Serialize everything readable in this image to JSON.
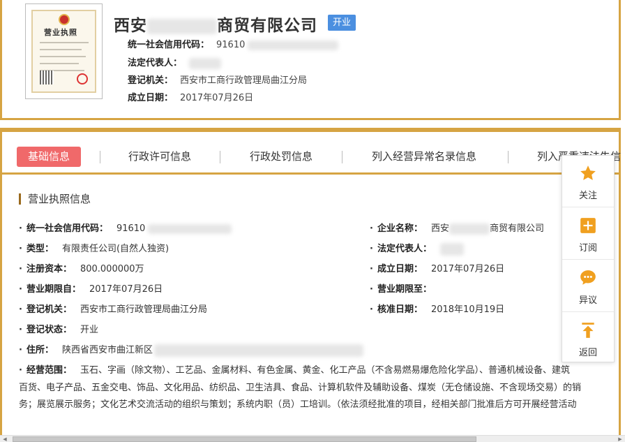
{
  "header": {
    "company_name_prefix": "西安",
    "company_name_suffix": "商贸有限公司",
    "status": "开业",
    "license_thumb_title": "营业执照",
    "credit_code_label": "统一社会信用代码：",
    "credit_code_value": "91610",
    "legal_rep_label": "法定代表人：",
    "authority_label": "登记机关：",
    "authority_value": "西安市工商行政管理局曲江分局",
    "founded_label": "成立日期：",
    "founded_value": "2017年07月26日"
  },
  "tabs": [
    {
      "label": "基础信息",
      "active": true
    },
    {
      "label": "行政许可信息"
    },
    {
      "label": "行政处罚信息"
    },
    {
      "label": "列入经营异常名录信息"
    },
    {
      "label": "列入严重违法失信"
    }
  ],
  "section": {
    "title": "营业执照信息",
    "fields": {
      "credit_code": {
        "label": "统一社会信用代码：",
        "value": "91610"
      },
      "company_name": {
        "label": "企业名称：",
        "value_prefix": "西安",
        "value_suffix": "商贸有限公司"
      },
      "type": {
        "label": "类型：",
        "value": "有限责任公司(自然人独资)"
      },
      "legal_rep": {
        "label": "法定代表人：",
        "value": ""
      },
      "capital": {
        "label": "注册资本：",
        "value": "800.000000万"
      },
      "founded": {
        "label": "成立日期：",
        "value": "2017年07月26日"
      },
      "term_from": {
        "label": "营业期限自：",
        "value": "2017年07月26日"
      },
      "term_to": {
        "label": "营业期限至：",
        "value": ""
      },
      "authority": {
        "label": "登记机关：",
        "value": "西安市工商行政管理局曲江分局"
      },
      "approved": {
        "label": "核准日期：",
        "value": "2018年10月19日"
      },
      "reg_status": {
        "label": "登记状态：",
        "value": "开业"
      },
      "address": {
        "label": "住所：",
        "value": "陕西省西安市曲江新区"
      },
      "scope": {
        "label": "经营范围：",
        "line1": "玉石、字画（除文物）、工艺品、金属材料、有色金属、黄金、化工产品（不含易燃易爆危险化学品）、普通机械设备、建筑",
        "line2": "百货、电子产品、五金交电、饰品、文化用品、纺织品、卫生洁具、食品、计算机软件及辅助设备、煤炭（无仓储设施、不含现场交易）的销",
        "line3": "务；展览展示服务；文化艺术交流活动的组织与策划；系统内职（员）工培训。（依法须经批准的项目，经相关部门批准后方可开展经营活动"
      }
    }
  },
  "side_toolbar": {
    "follow": "关注",
    "subscribe": "订阅",
    "objection": "异议",
    "back": "返回"
  },
  "colors": {
    "gold": "#d6a443",
    "active_tab": "#f0696a",
    "badge": "#4b8fe0",
    "icon_orange": "#f0a020"
  }
}
